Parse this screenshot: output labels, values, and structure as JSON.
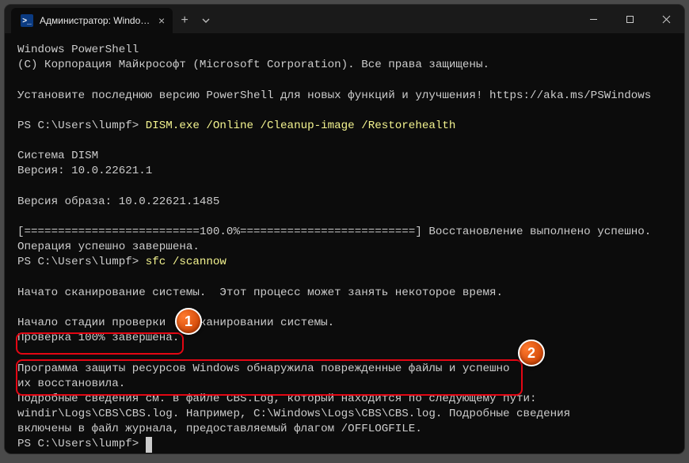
{
  "titlebar": {
    "tab_title": "Администратор: Windows Po",
    "ps_icon": ">_"
  },
  "term": {
    "l1": "Windows PowerShell",
    "l2": "(C) Корпорация Майкрософт (Microsoft Corporation). Все права защищены.",
    "l3": "Установите последнюю версию PowerShell для новых функций и улучшения! https://aka.ms/PSWindows",
    "p1_prompt": "PS C:\\Users\\lumpf> ",
    "p1_cmd": "DISM.exe /Online /Cleanup-image /Restorehealth",
    "l4": "Cистема DISM",
    "l5": "Версия: 10.0.22621.1",
    "l6": "Версия образа: 10.0.22621.1485",
    "l7": "[==========================100.0%==========================] Восстановление выполнено успешно.",
    "l8": "Операция успешно завершена.",
    "p2_prompt": "PS C:\\Users\\lumpf> ",
    "p2_cmd": "sfc /scannow",
    "l9": "Начато сканирование системы.  Этот процесс может занять некоторое время.",
    "l10a": "Начало стадии проверки ",
    "l10b": "канировании системы.",
    "l11": "Проверка 100% завершена.",
    "l12": "Программа защиты ресурсов Windows обнаружила поврежденные файлы и успешно",
    "l13": "их восстановила.",
    "l14": "Подробные сведения см. в файле CBS.Log, который находится по следующему пути:",
    "l15": "windir\\Logs\\CBS\\CBS.log. Например, C:\\Windows\\Logs\\CBS\\CBS.log. Подробные сведения",
    "l16": "включены в файл журнала, предоставляемый флагом /OFFLOGFILE.",
    "p3_prompt": "PS C:\\Users\\lumpf> "
  },
  "badges": {
    "b1": "1",
    "b2": "2"
  }
}
